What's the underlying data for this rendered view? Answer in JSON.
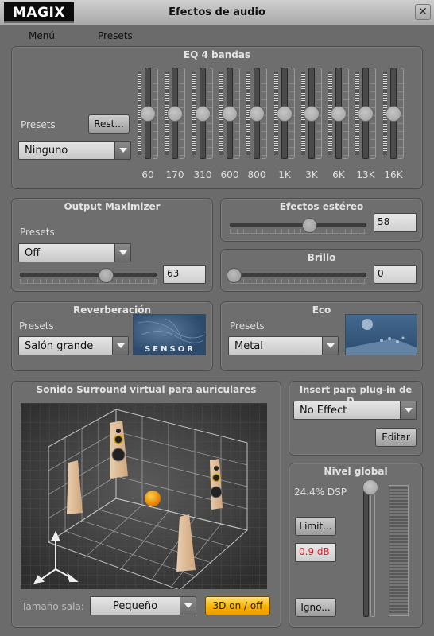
{
  "window": {
    "logo": "MAGIX",
    "title": "Efectos de audio",
    "close_glyph": "✕"
  },
  "menu": {
    "items": [
      "Menú",
      "Presets"
    ]
  },
  "eq": {
    "title": "EQ 4 bandas",
    "presets_label": "Presets",
    "reset_button": "Rest...",
    "preset_value": "Ninguno",
    "bands": [
      {
        "label": "60",
        "gain_fraction": 0.5
      },
      {
        "label": "170",
        "gain_fraction": 0.5
      },
      {
        "label": "310",
        "gain_fraction": 0.5
      },
      {
        "label": "600",
        "gain_fraction": 0.5
      },
      {
        "label": "800",
        "gain_fraction": 0.5
      },
      {
        "label": "1K",
        "gain_fraction": 0.5
      },
      {
        "label": "3K",
        "gain_fraction": 0.5
      },
      {
        "label": "6K",
        "gain_fraction": 0.5
      },
      {
        "label": "13K",
        "gain_fraction": 0.5
      },
      {
        "label": "16K",
        "gain_fraction": 0.5
      }
    ]
  },
  "output_maximizer": {
    "title": "Output Maximizer",
    "presets_label": "Presets",
    "preset_value": "Off",
    "value": "63",
    "slider_percent": 63
  },
  "stereo": {
    "title": "Efectos estéreo",
    "value": "58",
    "slider_percent": 58
  },
  "brillo": {
    "title": "Brillo",
    "value": "0",
    "slider_percent": 0
  },
  "reverb": {
    "title": "Reverberación",
    "presets_label": "Presets",
    "preset_value": "Salón grande",
    "thumb_text": "SENSOR"
  },
  "eco": {
    "title": "Eco",
    "presets_label": "Presets",
    "preset_value": "Metal"
  },
  "surround": {
    "title": "Sonido Surround virtual para auriculares",
    "room_size_label": "Tamaño sala:",
    "room_size_value": "Pequeño",
    "toggle_3d": "3D on / off"
  },
  "plugin": {
    "title": "Insert para plug-in de D...",
    "value": "No Effect",
    "edit_button": "Editar"
  },
  "global_level": {
    "title": "Nivel global",
    "dsp": "24.4% DSP",
    "limit_button": "Limit...",
    "level_readout": "0.9 dB",
    "ignore_button": "Igno...",
    "slider_fraction": 1.0,
    "level_color": "#e8202a"
  },
  "colors": {
    "accent_yellow": "#f8b300",
    "level_red": "#e8202a"
  }
}
